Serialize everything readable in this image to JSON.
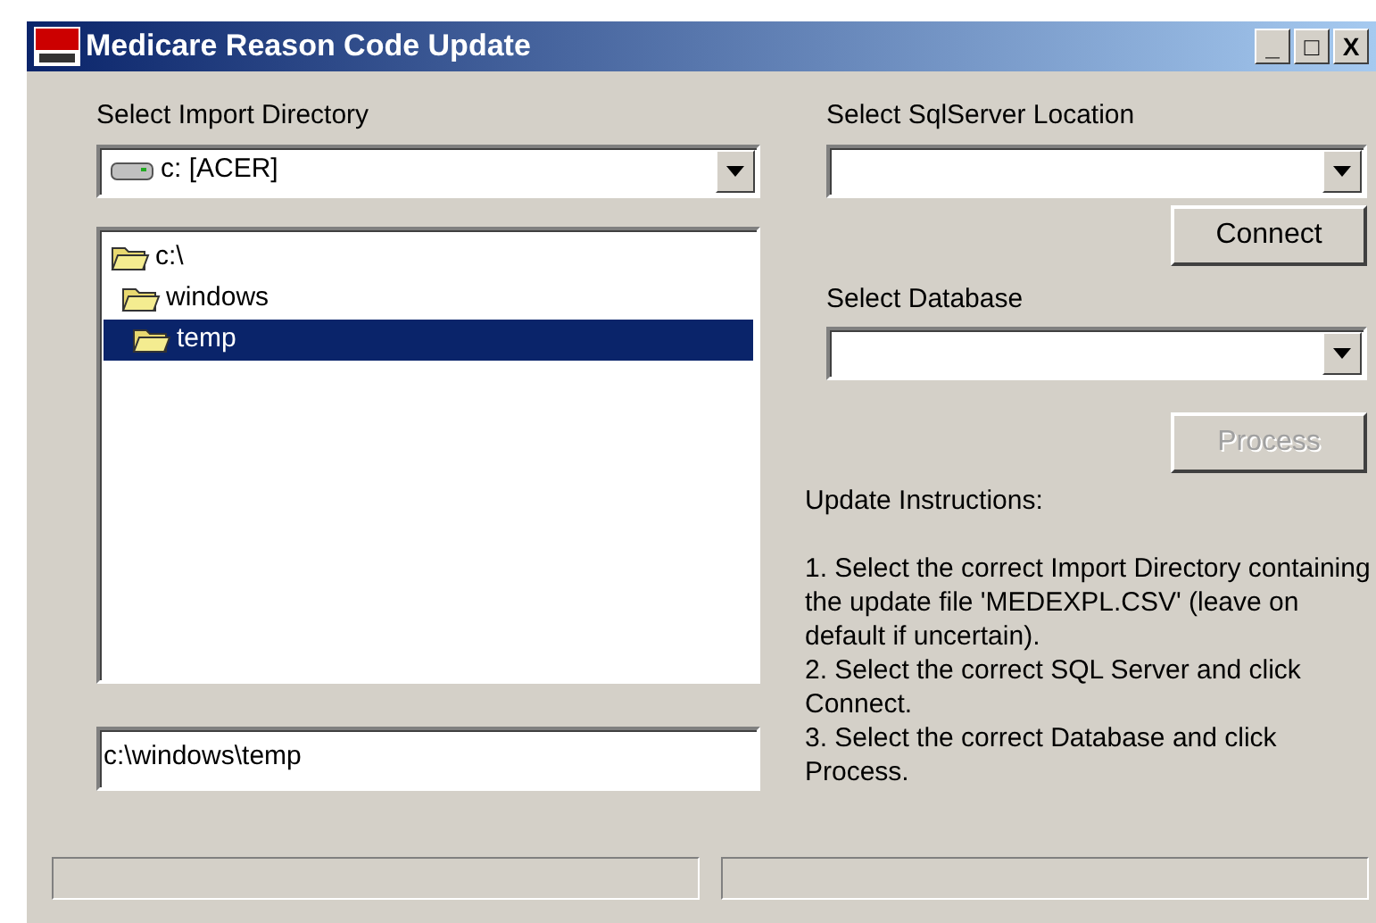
{
  "window": {
    "title": "Medicare Reason Code Update",
    "controls": [
      "_",
      "□",
      "X"
    ]
  },
  "import_directory": {
    "label": "Select Import Directory",
    "drive": "c: [ACER]",
    "tree": [
      {
        "label": "c:\\",
        "selected": false,
        "children": [
          {
            "label": "windows",
            "selected": false,
            "children": [
              {
                "label": "temp",
                "selected": true
              }
            ]
          }
        ]
      }
    ],
    "path": "c:\\windows\\temp"
  },
  "sql_server": {
    "label": "Select SqlServer Location",
    "button": {
      "label": "Connect",
      "disabled": false
    }
  },
  "database": {
    "label": "Select Database",
    "button": {
      "label": "Process",
      "disabled": true
    }
  },
  "instructions": {
    "heading": "Update Instructions:",
    "steps": [
      "1. Select the correct Import Directory containing the update file 'MEDEXPL.CSV' (leave on default if uncertain).",
      "2. Select the correct SQL Server and click Connect.",
      "3. Select the correct Database and click Process."
    ]
  }
}
